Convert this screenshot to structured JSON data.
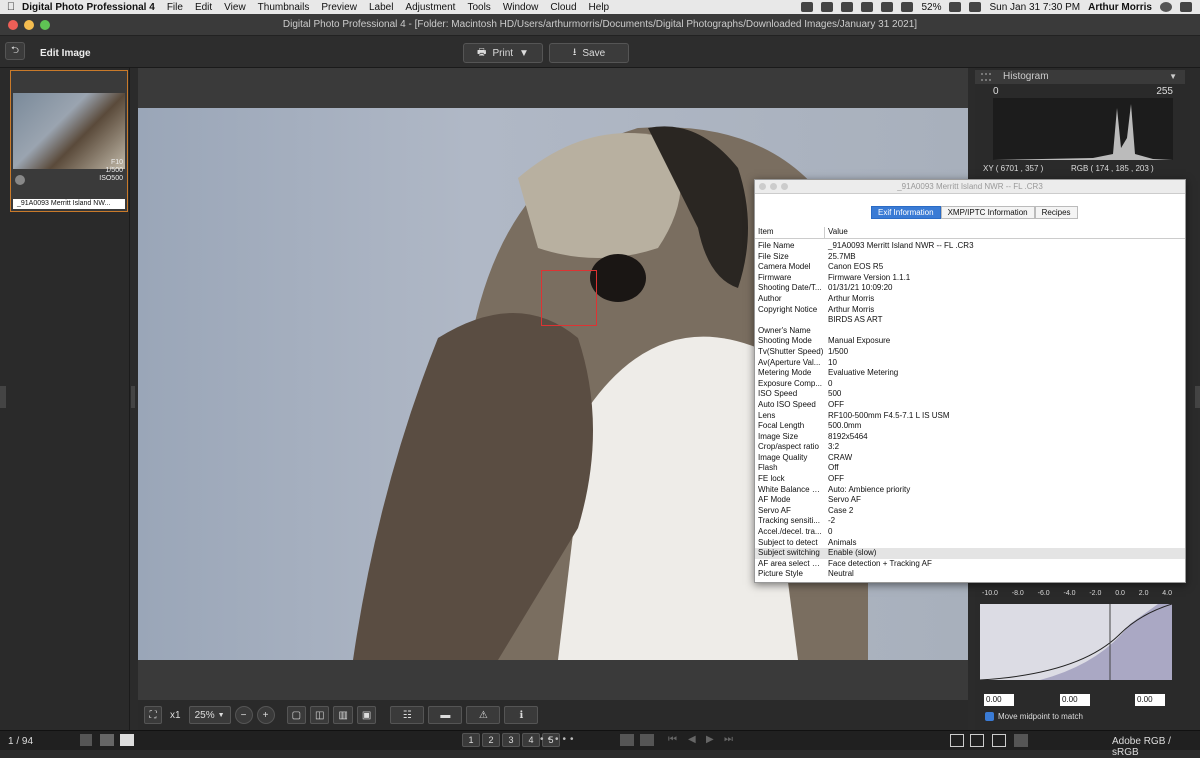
{
  "menubar": {
    "app_name": "Digital Photo Professional 4",
    "items": [
      "File",
      "Edit",
      "View",
      "Thumbnails",
      "Preview",
      "Label",
      "Adjustment",
      "Tools",
      "Window",
      "Cloud",
      "Help"
    ],
    "battery": "52%",
    "clock": "Sun Jan 31  7:30 PM",
    "user": "Arthur Morris"
  },
  "window": {
    "title": "Digital Photo Professional 4 - [Folder: Macintosh HD/Users/arthurmorris/Documents/Digital Photographs/Downloaded Images/January 31 2021]"
  },
  "toolbar": {
    "mode_label": "Edit Image",
    "print_label": "Print",
    "save_label": "Save"
  },
  "thumbnail": {
    "aperture": "F10",
    "shutter": "1/500",
    "iso": "ISO500",
    "filename": "_91A0093  Merritt Island NW..."
  },
  "bottombar": {
    "zoom_x1": "x1",
    "zoom_pct": "25%"
  },
  "statusbar": {
    "count": "1 / 94",
    "stars": [
      "1",
      "2",
      "3",
      "4",
      "5"
    ],
    "colorspace": "Adobe RGB / sRGB"
  },
  "histogram": {
    "title": "Histogram",
    "min": "0",
    "max": "255",
    "xy": "XY (    6701 ,      357 )",
    "rgb": "RGB (    174 ,    185 ,    203 )"
  },
  "exif_window": {
    "title": "_91A0093  Merritt Island NWR -- FL .CR3",
    "tabs": [
      "Exif Information",
      "XMP/IPTC Information",
      "Recipes"
    ],
    "col_item": "Item",
    "col_value": "Value",
    "rows": [
      {
        "item": "File Name",
        "value": "_91A0093  Merritt Island NWR -- FL .CR3"
      },
      {
        "item": "File Size",
        "value": "25.7MB"
      },
      {
        "item": "Camera Model",
        "value": "Canon EOS R5"
      },
      {
        "item": "Firmware",
        "value": "Firmware Version 1.1.1"
      },
      {
        "item": "Shooting Date/T...",
        "value": "01/31/21 10:09:20"
      },
      {
        "item": "Author",
        "value": "Arthur Morris"
      },
      {
        "item": "Copyright Notice",
        "value": "Arthur Morris"
      },
      {
        "item": "",
        "value": "BIRDS AS ART"
      },
      {
        "item": "Owner's Name",
        "value": ""
      },
      {
        "item": "Shooting Mode",
        "value": "Manual Exposure"
      },
      {
        "item": "Tv(Shutter Speed)",
        "value": "1/500"
      },
      {
        "item": "Av(Aperture Val...",
        "value": "10"
      },
      {
        "item": "Metering Mode",
        "value": "Evaluative Metering"
      },
      {
        "item": "Exposure Comp...",
        "value": "0"
      },
      {
        "item": "ISO Speed",
        "value": "500"
      },
      {
        "item": "Auto ISO Speed",
        "value": "OFF"
      },
      {
        "item": "Lens",
        "value": "RF100-500mm F4.5-7.1 L IS USM"
      },
      {
        "item": "Focal Length",
        "value": "500.0mm"
      },
      {
        "item": "Image Size",
        "value": "8192x5464"
      },
      {
        "item": "Crop/aspect ratio",
        "value": "3:2"
      },
      {
        "item": "Image Quality",
        "value": "CRAW"
      },
      {
        "item": "Flash",
        "value": "Off"
      },
      {
        "item": "FE lock",
        "value": "OFF"
      },
      {
        "item": "White Balance M...",
        "value": "Auto: Ambience priority"
      },
      {
        "item": "AF Mode",
        "value": "Servo AF"
      },
      {
        "item": "Servo AF",
        "value": "Case 2"
      },
      {
        "item": "Tracking sensiti...",
        "value": "-2"
      },
      {
        "item": "Accel./decel. tra...",
        "value": "0"
      },
      {
        "item": "Subject to detect",
        "value": "Animals"
      },
      {
        "item": "Subject switching",
        "value": "Enable (slow)"
      },
      {
        "item": "AF area select m...",
        "value": "Face detection + Tracking AF"
      },
      {
        "item": "Picture Style",
        "value": "Neutral"
      }
    ]
  },
  "tone_curve": {
    "ticks": [
      "-10.0",
      "-8.0",
      "-6.0",
      "-4.0",
      "-2.0",
      "0.0",
      "2.0",
      "4.0"
    ],
    "field_left": "0.00",
    "field_mid": "0.00",
    "field_right": "0.00",
    "checkbox_label": "Move midpoint to match",
    "checkbox_checked": true
  }
}
